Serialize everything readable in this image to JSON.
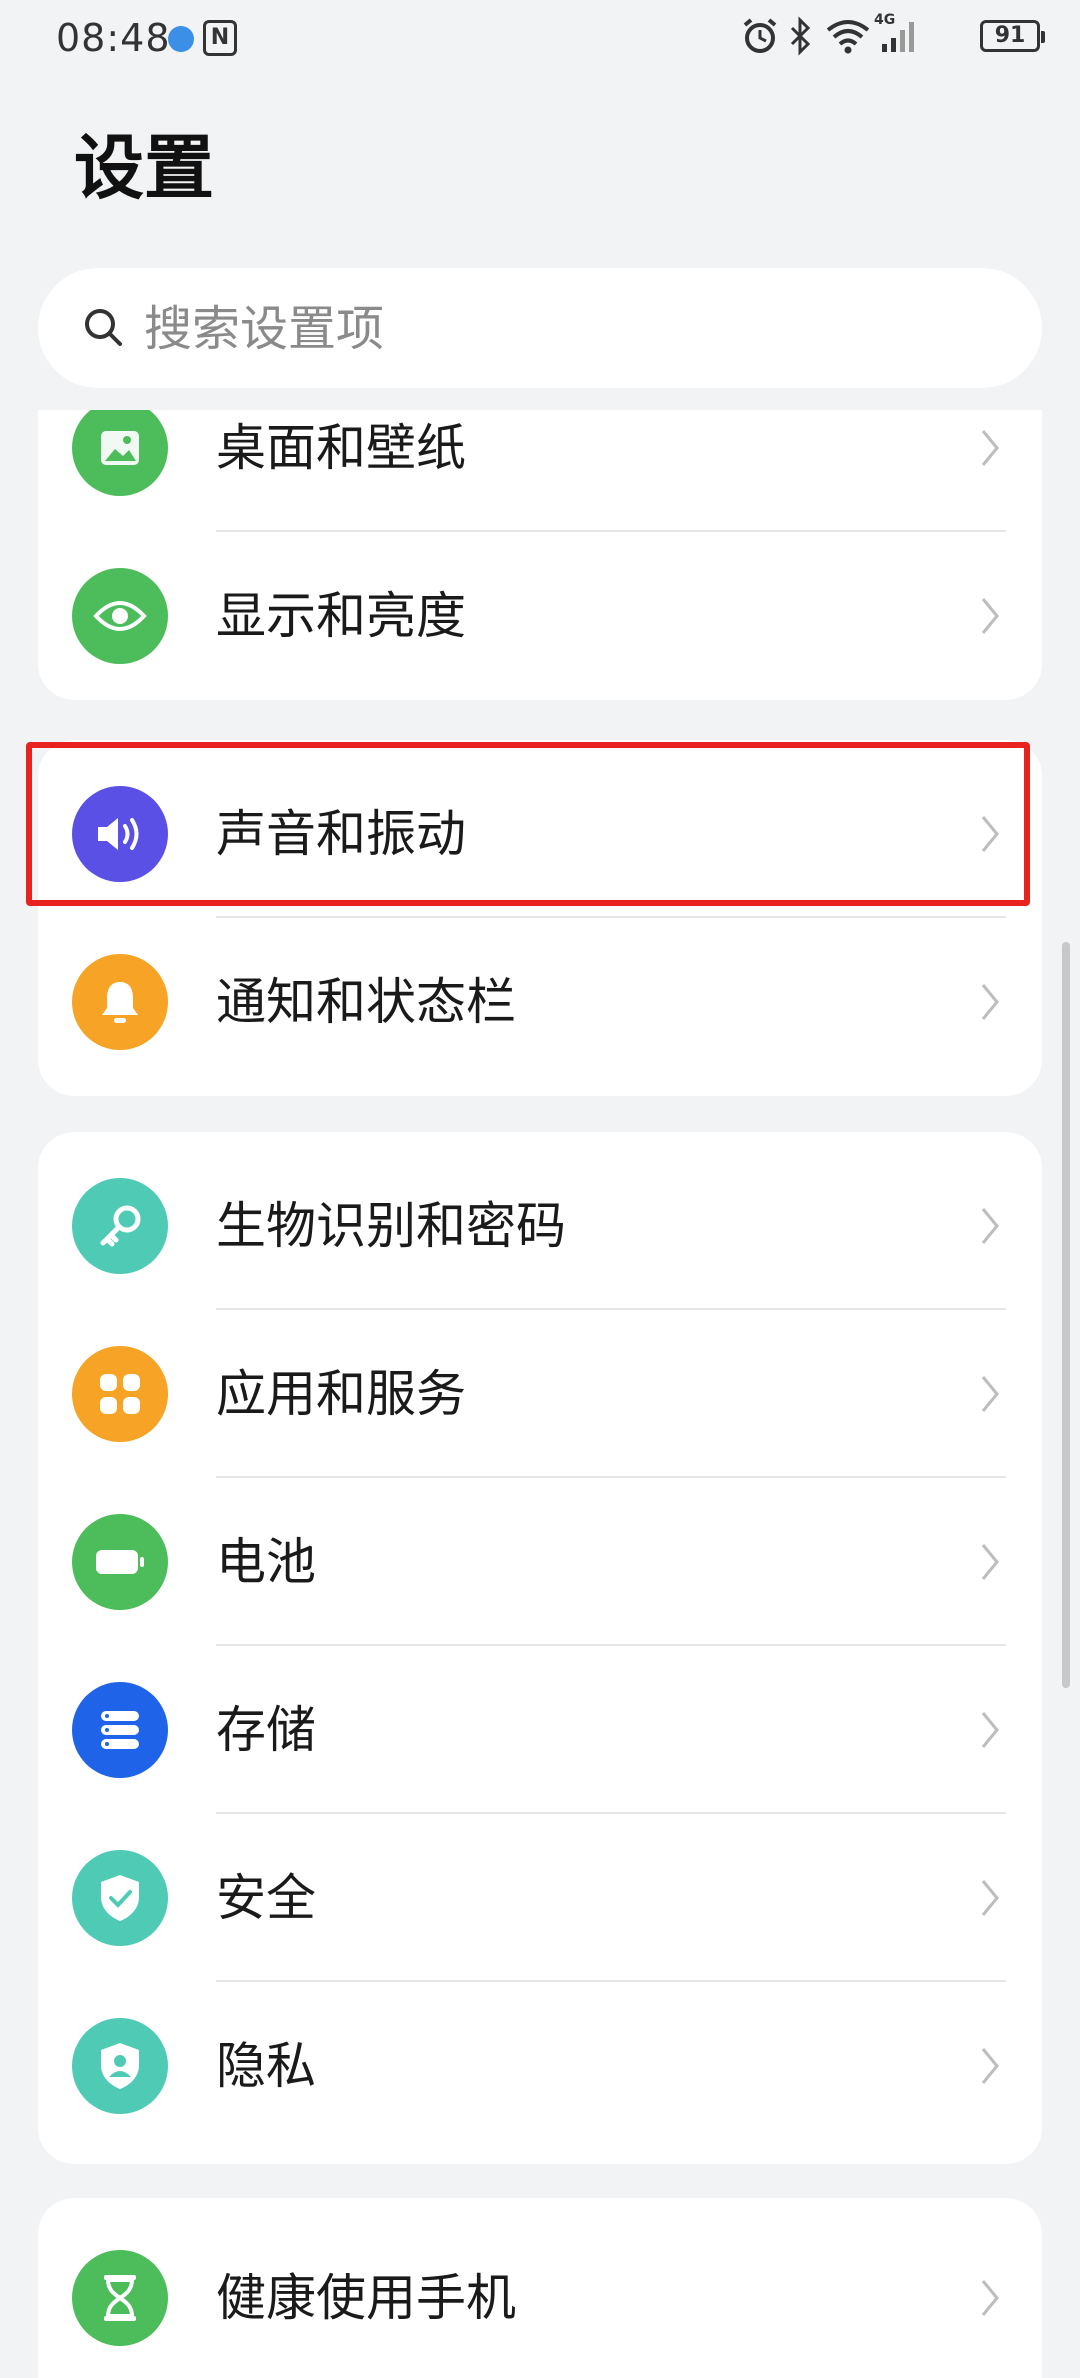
{
  "status_bar": {
    "time": "08:48",
    "nfc": "N",
    "battery": "91",
    "network": "4G"
  },
  "title": "设置",
  "search": {
    "placeholder": "搜索设置项"
  },
  "groups": [
    {
      "items": [
        {
          "label": "桌面和壁纸",
          "icon": "wallpaper-icon",
          "color": "#4cbd5a"
        },
        {
          "label": "显示和亮度",
          "icon": "eye-icon",
          "color": "#4cbd5a"
        }
      ]
    },
    {
      "items": [
        {
          "label": "声音和振动",
          "icon": "speaker-icon",
          "color": "#5a50e6",
          "highlighted": true
        },
        {
          "label": "通知和状态栏",
          "icon": "bell-icon",
          "color": "#f7a325"
        }
      ]
    },
    {
      "items": [
        {
          "label": "生物识别和密码",
          "icon": "key-icon",
          "color": "#4fcbb5"
        },
        {
          "label": "应用和服务",
          "icon": "apps-icon",
          "color": "#f7a325"
        },
        {
          "label": "电池",
          "icon": "battery-icon",
          "color": "#4cbd5a"
        },
        {
          "label": "存储",
          "icon": "storage-icon",
          "color": "#1f64e8"
        },
        {
          "label": "安全",
          "icon": "shield-check-icon",
          "color": "#4fcbb5"
        },
        {
          "label": "隐私",
          "icon": "privacy-shield-icon",
          "color": "#4fcbb5"
        }
      ]
    },
    {
      "items": [
        {
          "label": "健康使用手机",
          "icon": "hourglass-icon",
          "color": "#4cbd5a"
        }
      ]
    }
  ],
  "colors": {
    "highlight": "#e8231f",
    "background": "#f1f3f5"
  }
}
